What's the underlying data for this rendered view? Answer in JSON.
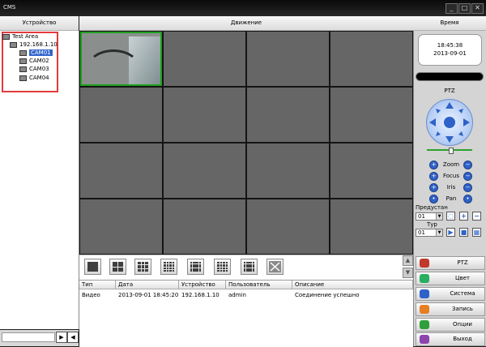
{
  "window": {
    "title": "CMS",
    "controls": [
      "minimize-icon",
      "maximize-icon",
      "close-icon"
    ]
  },
  "headers": {
    "devices": "Устройство",
    "motion": "Движение",
    "time": "Время"
  },
  "device_tree": {
    "root": "Test Area",
    "device": "192.168.1.10",
    "cameras": [
      "CAM01",
      "CAM02",
      "CAM03",
      "CAM04"
    ],
    "selected": "CAM01"
  },
  "clock": {
    "time": "18:45:38",
    "date": "2013-09-01"
  },
  "ptz": {
    "title": "PTZ",
    "controls": [
      "Zoom",
      "Focus",
      "Iris",
      "Pan"
    ],
    "preset_label": "Предустан",
    "preset_value": "01",
    "tour_label": "Тур",
    "tour_value": "01"
  },
  "layouts": [
    "1x1",
    "2x2",
    "3x3",
    "4x4",
    "5x5",
    "6x6",
    "8x8",
    "fullscreen"
  ],
  "log": {
    "columns": [
      "Тип",
      "Дата",
      "Устройство",
      "Пользователь",
      "Описание"
    ],
    "rows": [
      {
        "type": "Видео",
        "date": "2013-09-01 18:45:20",
        "device": "192.168.1.10",
        "user": "admin",
        "desc": "Соединение успешно"
      }
    ]
  },
  "menu": [
    {
      "label": "PTZ",
      "icon": "ptz-icon",
      "color": "#c0392b"
    },
    {
      "label": "Цвет",
      "icon": "color-icon",
      "color": "#27ae60"
    },
    {
      "label": "Система",
      "icon": "system-icon",
      "color": "#2f62c8"
    },
    {
      "label": "Запись",
      "icon": "record-icon",
      "color": "#e67e22"
    },
    {
      "label": "Опции",
      "icon": "options-icon",
      "color": "#2e9e3a"
    },
    {
      "label": "Выход",
      "icon": "exit-icon",
      "color": "#8e44ad"
    }
  ]
}
